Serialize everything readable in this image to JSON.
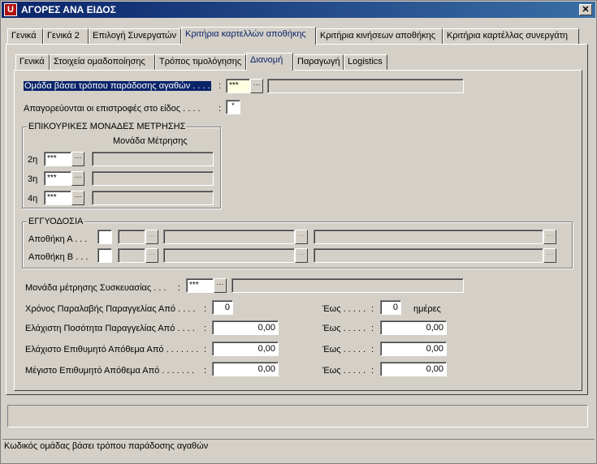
{
  "window": {
    "title": "ΑΓΟΡΕΣ ΑΝΑ ΕΙΔΟΣ",
    "close_glyph": "✕"
  },
  "top_tabs": [
    {
      "label": "Γενικά"
    },
    {
      "label": "Γενικά 2"
    },
    {
      "label": "Επιλογή Συνεργατών"
    },
    {
      "label": "Κριτήρια καρτελλών αποθήκης"
    },
    {
      "label": "Κριτήρια κινήσεων αποθήκης"
    },
    {
      "label": "Κριτήρια καρτέλλας συνεργάτη"
    }
  ],
  "sub_tabs": [
    {
      "label": "Γενικά"
    },
    {
      "label": "Στοιχεία ομαδοποίησης"
    },
    {
      "label": "Τρόπος τιμολόγησης"
    },
    {
      "label": "Διανομή"
    },
    {
      "label": "Παραγωγή"
    },
    {
      "label": "Logistics"
    }
  ],
  "form": {
    "delivery_group_label": "Ομάδα βάσει τρόπου παράδοσης αγαθών . . . .",
    "delivery_group_value": "***",
    "returns_label": "Απαγορεύονται οι επιστροφές στο είδος . . . .",
    "returns_value": "*",
    "colon": ":",
    "aux_units": {
      "title": "ΕΠΙΚΟΥΡΙΚΕΣ ΜΟΝΑΔΕΣ ΜΕΤΡΗΣΗΣ",
      "column_header": "Μονάδα Μέτρησης",
      "rows": [
        {
          "label": "2η",
          "value": "***"
        },
        {
          "label": "3η",
          "value": "***"
        },
        {
          "label": "4η",
          "value": "***"
        }
      ]
    },
    "guarantee": {
      "title": "ΕΓΓΥΟΔΟΣΙΑ",
      "rows": [
        {
          "label": "Αποθήκη Α . . ."
        },
        {
          "label": "Αποθήκη Β . . ."
        }
      ]
    },
    "packaging_label": "Μονάδα μέτρησης Συσκευασίας . . .",
    "packaging_value": "***",
    "order_time_label": "Χρόνος Παραλαβής Παραγγελίας  Από . . . .",
    "order_time_from": "0",
    "order_time_to": "0",
    "days_label": "ημέρες",
    "to_label": "Έως . . . . .",
    "min_qty_label": "Ελάχιστη Ποσότητα Παραγγελίας  Από . . . .",
    "min_qty_from": "0,00",
    "min_qty_to": "0,00",
    "min_stock_label": "Ελάχιστο Επιθυμητό Απόθεμα  Από . . . . . . .",
    "min_stock_from": "0,00",
    "min_stock_to": "0,00",
    "max_stock_label": "Μέγιστο Επιθυμητό Απόθεμα  Από . . . . . . .",
    "max_stock_from": "0,00",
    "max_stock_to": "0,00",
    "dd_glyph": "···"
  },
  "status": {
    "text": "Κωδικός ομάδας βάσει τρόπου παράδοσης αγαθών"
  }
}
